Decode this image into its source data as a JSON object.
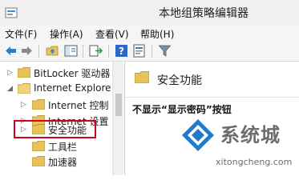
{
  "window": {
    "title": "本地组策略编辑器"
  },
  "menu": [
    "文件(F)",
    "操作(A)",
    "查看(V)",
    "帮助(H)"
  ],
  "toolbar": {
    "icons": [
      "back-arrow-icon",
      "forward-arrow-icon",
      "up-folder-icon",
      "show-hide-tree-icon",
      "export-list-icon",
      "help-icon",
      "properties-icon",
      "filter-icon"
    ]
  },
  "tree": {
    "nodes": [
      {
        "label": "BitLocker 驱动器",
        "expander": "▷"
      },
      {
        "label": "Internet Explore",
        "expander": "◢"
      },
      {
        "label": "Internet 控制",
        "expander": "▷"
      },
      {
        "label": "Internet 设置",
        "expander": "▷"
      },
      {
        "label": "安全功能",
        "expander": "▷"
      },
      {
        "label": "工具栏",
        "expander": ""
      },
      {
        "label": "加速器",
        "expander": ""
      }
    ]
  },
  "right_panel": {
    "title": "安全功能",
    "policy": "不显示“显示密码”按钮"
  },
  "watermark": {
    "brand": "系统城",
    "url": "xitongcheng.com"
  },
  "colors": {
    "highlight_border": "#d0021b",
    "folder": "#e8c35a",
    "accent": "#1f7acb"
  }
}
